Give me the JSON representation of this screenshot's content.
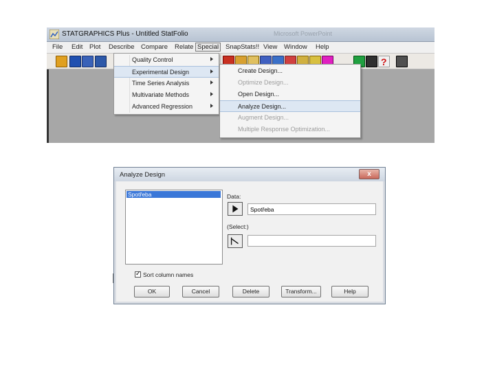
{
  "app": {
    "title": "STATGRAPHICS Plus - Untitled StatFolio",
    "background_title": "Microsoft PowerPoint"
  },
  "menubar": {
    "items": [
      "File",
      "Edit",
      "Plot",
      "Describe",
      "Compare",
      "Relate",
      "Special",
      "SnapStats!!",
      "View",
      "Window",
      "Help"
    ],
    "active": "Special"
  },
  "special_menu": {
    "items": [
      {
        "label": "Quality Control",
        "submenu": true
      },
      {
        "label": "Experimental Design",
        "submenu": true
      },
      {
        "label": "Time Series Analysis",
        "submenu": true
      },
      {
        "label": "Multivariate Methods",
        "submenu": true
      },
      {
        "label": "Advanced Regression",
        "submenu": true
      }
    ],
    "highlighted": "Experimental Design"
  },
  "experimental_design_menu": {
    "items": [
      {
        "label": "Create Design...",
        "enabled": true
      },
      {
        "label": "Optimize Design...",
        "enabled": false
      },
      {
        "label": "Open Design...",
        "enabled": true
      },
      {
        "label": "Analyze Design...",
        "enabled": true
      },
      {
        "label": "Augment Design...",
        "enabled": false
      },
      {
        "label": "Multiple Response Optimization...",
        "enabled": false
      }
    ],
    "highlighted": "Analyze Design..."
  },
  "toolbar": {
    "icons": [
      "open-folder-icon",
      "save-disk-icon",
      "calculator-icon",
      "data-table-icon",
      "chart-icon",
      "table-icon",
      "plot-icon",
      "scatter-icon",
      "graph-icon",
      "save-statfolio-icon",
      "grid-icon",
      "palette-icon",
      "home-icon",
      "person-icon",
      "help-icon",
      "film-icon"
    ]
  },
  "dialog": {
    "title": "Analyze Design",
    "close_label": "x",
    "list_items": [
      "Spotřeba"
    ],
    "selected_item": "Spotřeba",
    "data_label": "Data:",
    "data_value": "Spotřeba",
    "select_label": "(Select:)",
    "select_value": "",
    "sort_checkbox_label": "Sort column names",
    "sort_checked": true,
    "buttons": {
      "ok": "OK",
      "cancel": "Cancel",
      "delete": "Delete",
      "transform": "Transform...",
      "help": "Help"
    }
  },
  "colors": {
    "selection": "#3a77d8",
    "menu_highlight": "#dde7f3",
    "workspace": "#a7a7a7"
  }
}
